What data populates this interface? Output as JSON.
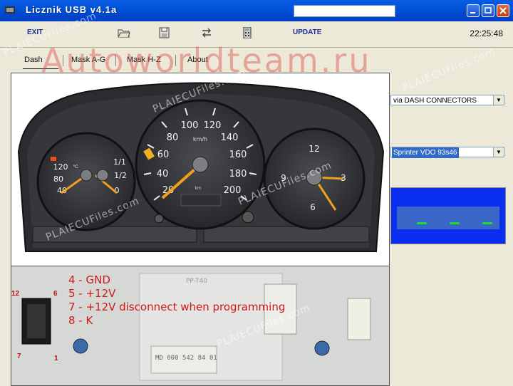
{
  "window": {
    "title": "Licznik USB v4.1a",
    "title_box": ""
  },
  "toolbar": {
    "exit_label": "EXIT",
    "update_label": "UPDATE",
    "clock": "22:25:48"
  },
  "tabs": [
    {
      "label": "Dash"
    },
    {
      "label": "Mask A-G"
    },
    {
      "label": "Mask H-Z"
    },
    {
      "label": "About"
    }
  ],
  "watermarks": {
    "brand": "Autoworldteam.ru",
    "site": "PLAIECUFiles.com"
  },
  "controls": {
    "connection_select": "via DASH CONNECTORS",
    "model_select": "Sprinter VDO 93s46"
  },
  "cluster": {
    "speedo_labels": [
      "20",
      "40",
      "60",
      "80",
      "100",
      "120",
      "140",
      "160",
      "180",
      "200"
    ],
    "speedo_unit": "km/h",
    "odo_unit": "km",
    "temp_labels": [
      "40",
      "80",
      "120"
    ],
    "temp_unit": "°C",
    "fuel_labels": [
      "0",
      "1/2",
      "1/1"
    ],
    "tacho_labels": [
      "12",
      "3",
      "6",
      "9"
    ]
  },
  "pinout": {
    "lines": [
      "4 - GND",
      "5 - +12V",
      "7 - +12V disconnect when programming",
      "8 - K"
    ],
    "connector_pins": {
      "top_left": "12",
      "top_right": "6",
      "bottom_left": "7",
      "bottom_right": "1"
    },
    "label_text": "MD 000 542 84 01",
    "sticker_text": "PP-T40"
  },
  "colors": {
    "titlebar": "#0054e3",
    "display_bg": "#0a2ef0",
    "display_segments": "#1edc2a",
    "needle": "#f0a020",
    "pinout_text": "#d01818"
  }
}
